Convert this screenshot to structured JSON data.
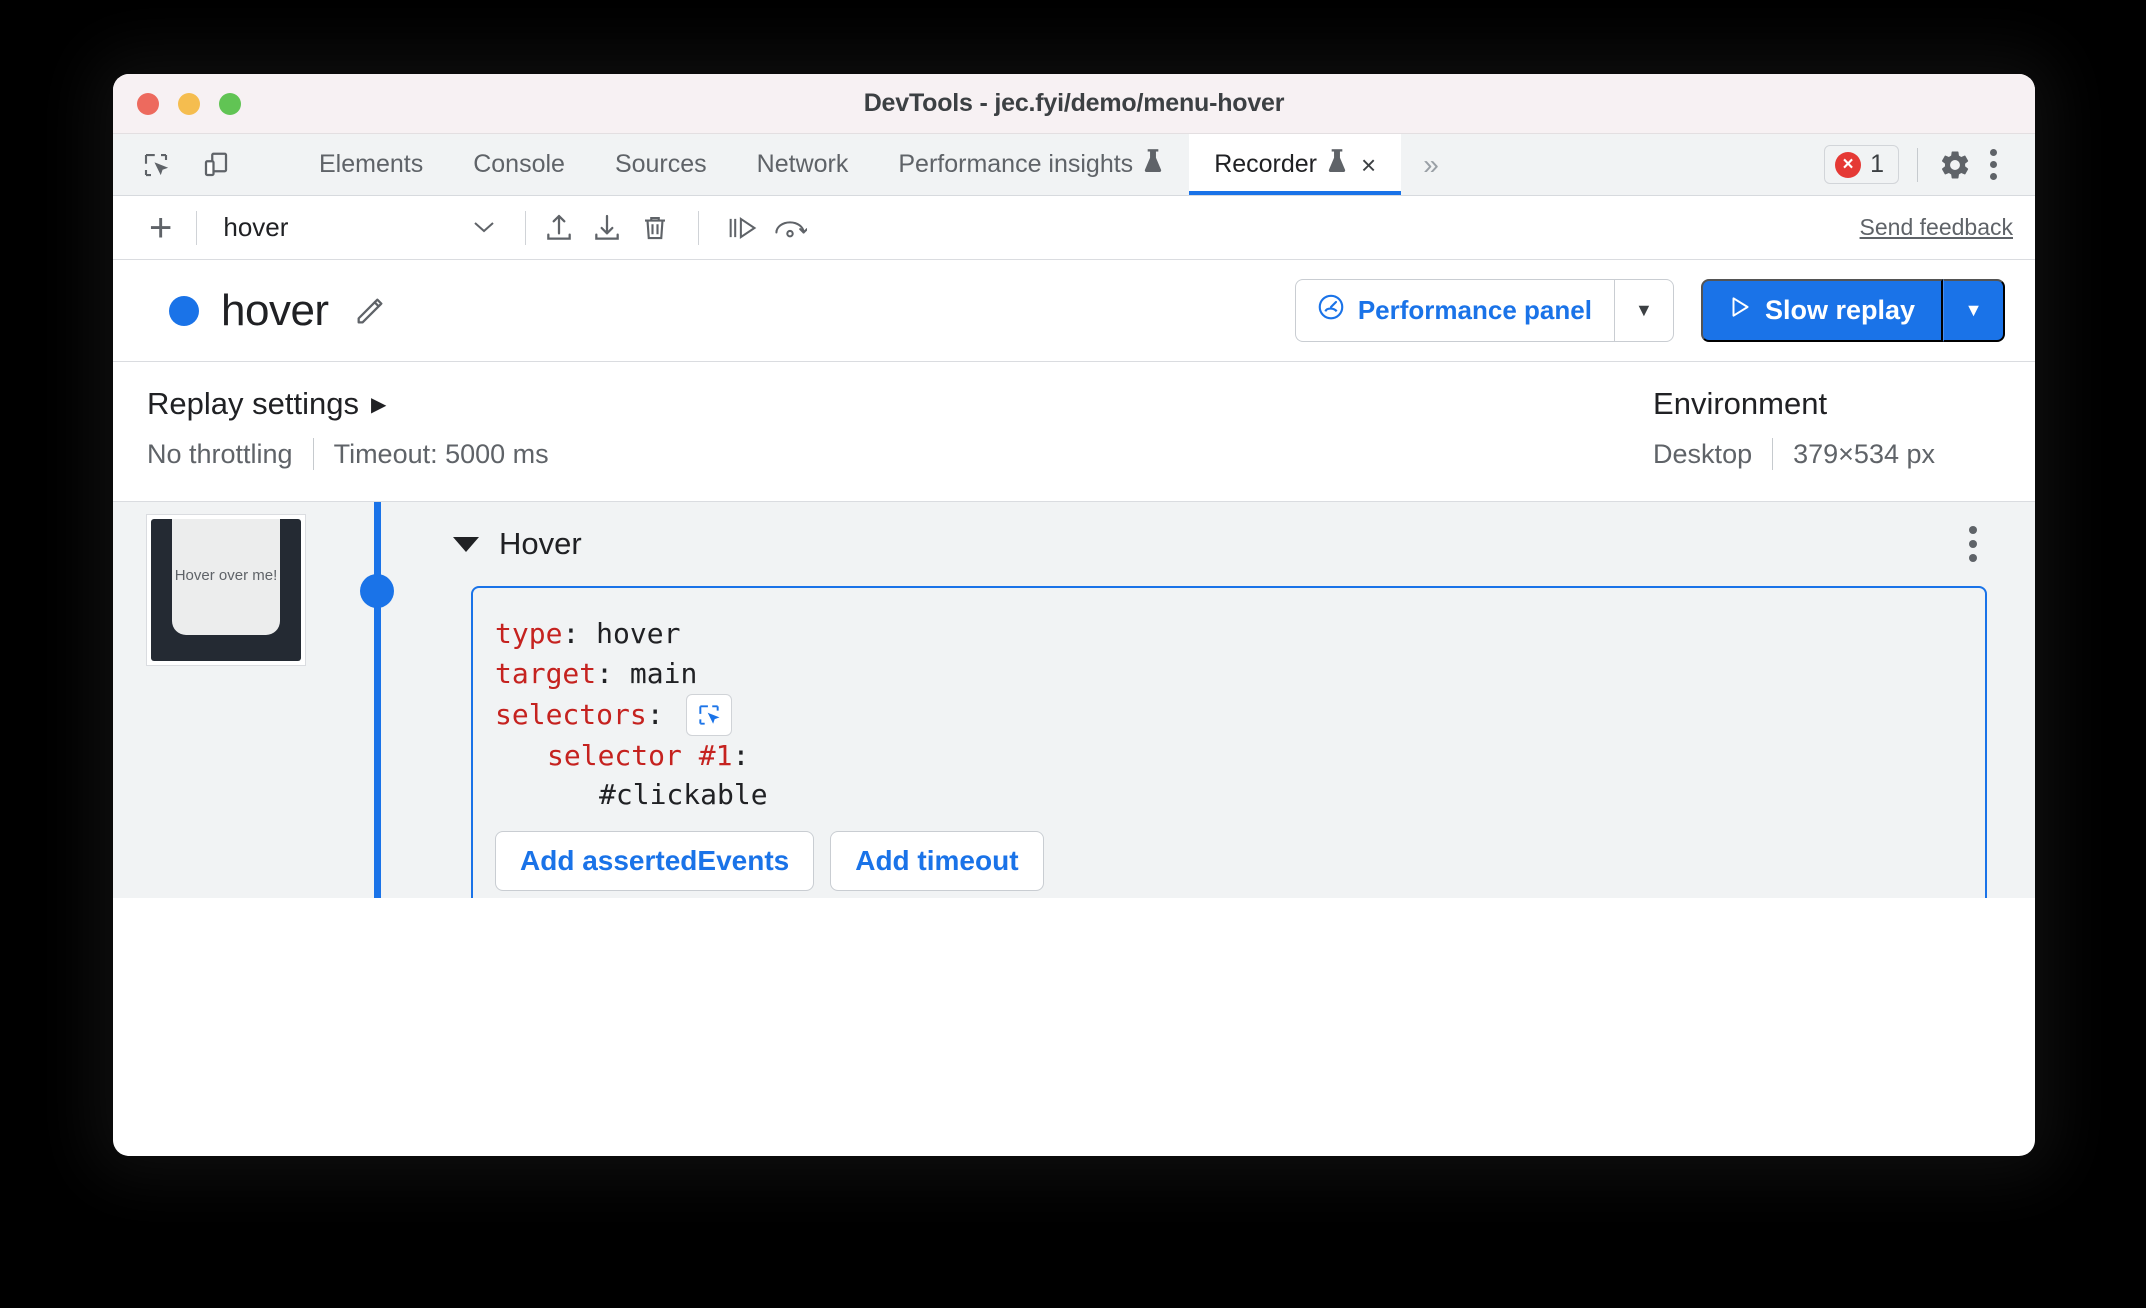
{
  "window": {
    "title": "DevTools - jec.fyi/demo/menu-hover"
  },
  "tabbar": {
    "left_icons": [
      {
        "name": "inspect-element-icon"
      },
      {
        "name": "device-toolbar-icon"
      }
    ],
    "tabs": [
      {
        "label": "Elements",
        "active": false,
        "experimental": false
      },
      {
        "label": "Console",
        "active": false,
        "experimental": false
      },
      {
        "label": "Sources",
        "active": false,
        "experimental": false
      },
      {
        "label": "Network",
        "active": false,
        "experimental": false
      },
      {
        "label": "Performance insights",
        "active": false,
        "experimental": true
      },
      {
        "label": "Recorder",
        "active": true,
        "experimental": true,
        "closable": true
      }
    ],
    "overflow_label": "»",
    "close_glyph": "×",
    "error_count": "1",
    "error_color": "#e53935",
    "error_glyph": "×",
    "settings_icon": "gear-icon",
    "more_icon": "kebab-menu-icon"
  },
  "toolbar": {
    "add_label": "+",
    "recording_name": "hover",
    "chevron": "⌄",
    "icons": [
      {
        "name": "import-icon"
      },
      {
        "name": "export-icon"
      },
      {
        "name": "delete-icon"
      },
      {
        "name": "step-over-icon"
      },
      {
        "name": "replay-undo-icon"
      }
    ],
    "feedback_label": "Send feedback"
  },
  "recording_header": {
    "status_color": "#1a73e8",
    "title": "hover",
    "edit_icon": "pencil-icon",
    "perf_button": {
      "label": "Performance panel",
      "icon": "performance-gauge-icon",
      "caret": "▼"
    },
    "replay_button": {
      "label": "Slow replay",
      "icon": "play-triangle-icon",
      "caret": "▼",
      "color": "#1a73e8"
    }
  },
  "settings": {
    "replay": {
      "heading": "Replay settings",
      "caret": "▶",
      "throttling": "No throttling",
      "timeout": "Timeout: 5000 ms"
    },
    "environment": {
      "heading": "Environment",
      "device": "Desktop",
      "viewport": "379×534 px"
    }
  },
  "steps": {
    "thumbnail_caption": "Hover over me!",
    "step": {
      "name": "Hover",
      "expanded": true,
      "more_icon": "kebab-menu-icon",
      "fields": {
        "type_key": "type",
        "type_value": ": hover",
        "target_key": "target",
        "target_value": ": main",
        "selectors_key": "selectors",
        "selectors_colon": ":",
        "selector_picker_icon": "select-element-icon",
        "selector_1_key": "selector #1",
        "selector_1_colon": ":",
        "selector_1_value": "#clickable"
      },
      "buttons": [
        {
          "label": "Add assertedEvents"
        },
        {
          "label": "Add timeout"
        }
      ]
    }
  }
}
